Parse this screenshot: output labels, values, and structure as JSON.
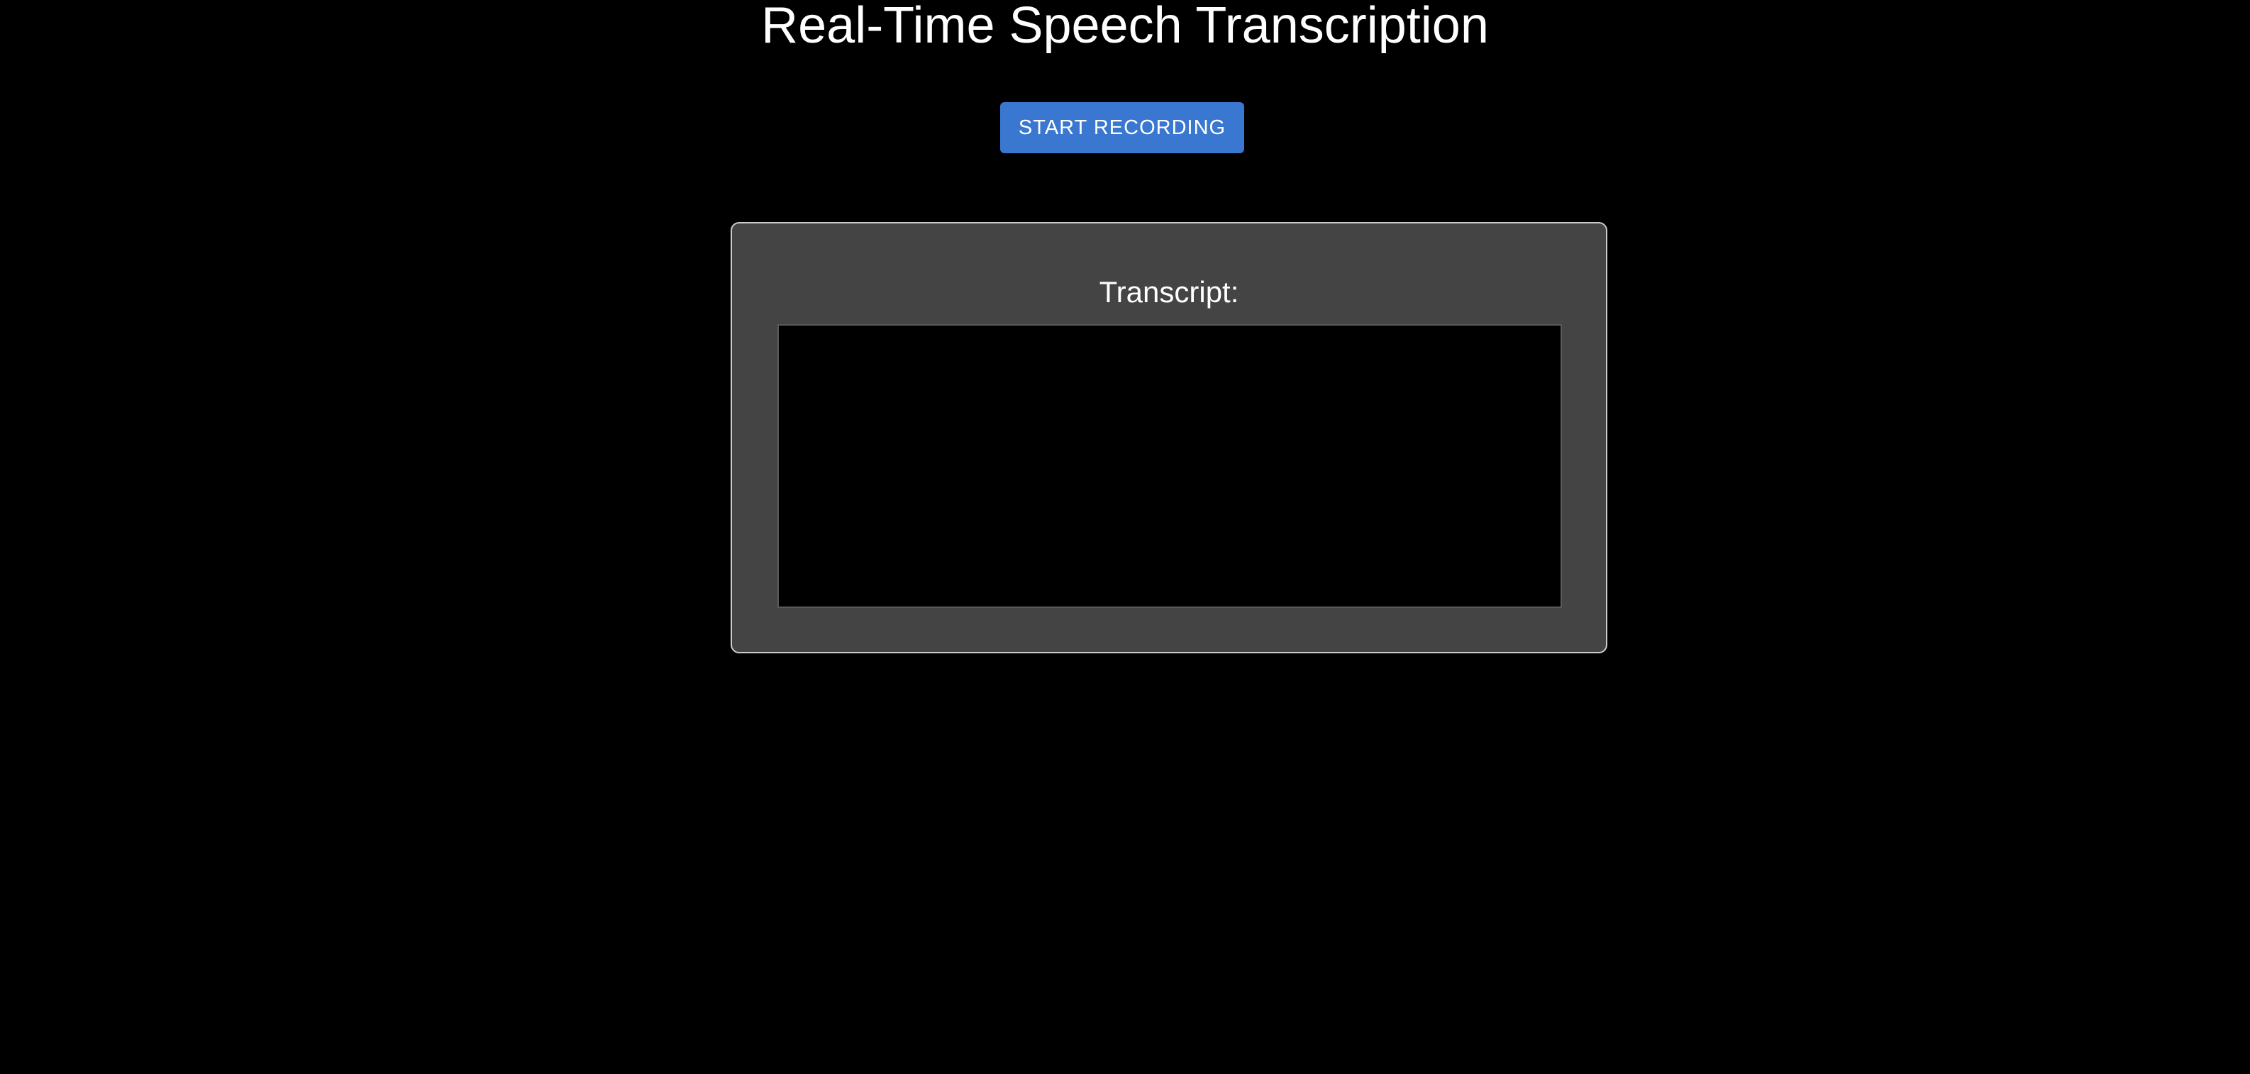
{
  "header": {
    "title": "Real-Time Speech Transcription"
  },
  "controls": {
    "record_button_label": "START RECORDING"
  },
  "transcript": {
    "label": "Transcript:",
    "value": ""
  },
  "colors": {
    "background": "#000000",
    "button": "#3a77d0",
    "panel": "#444444",
    "panel_border": "#cccccc",
    "text": "#ffffff"
  }
}
